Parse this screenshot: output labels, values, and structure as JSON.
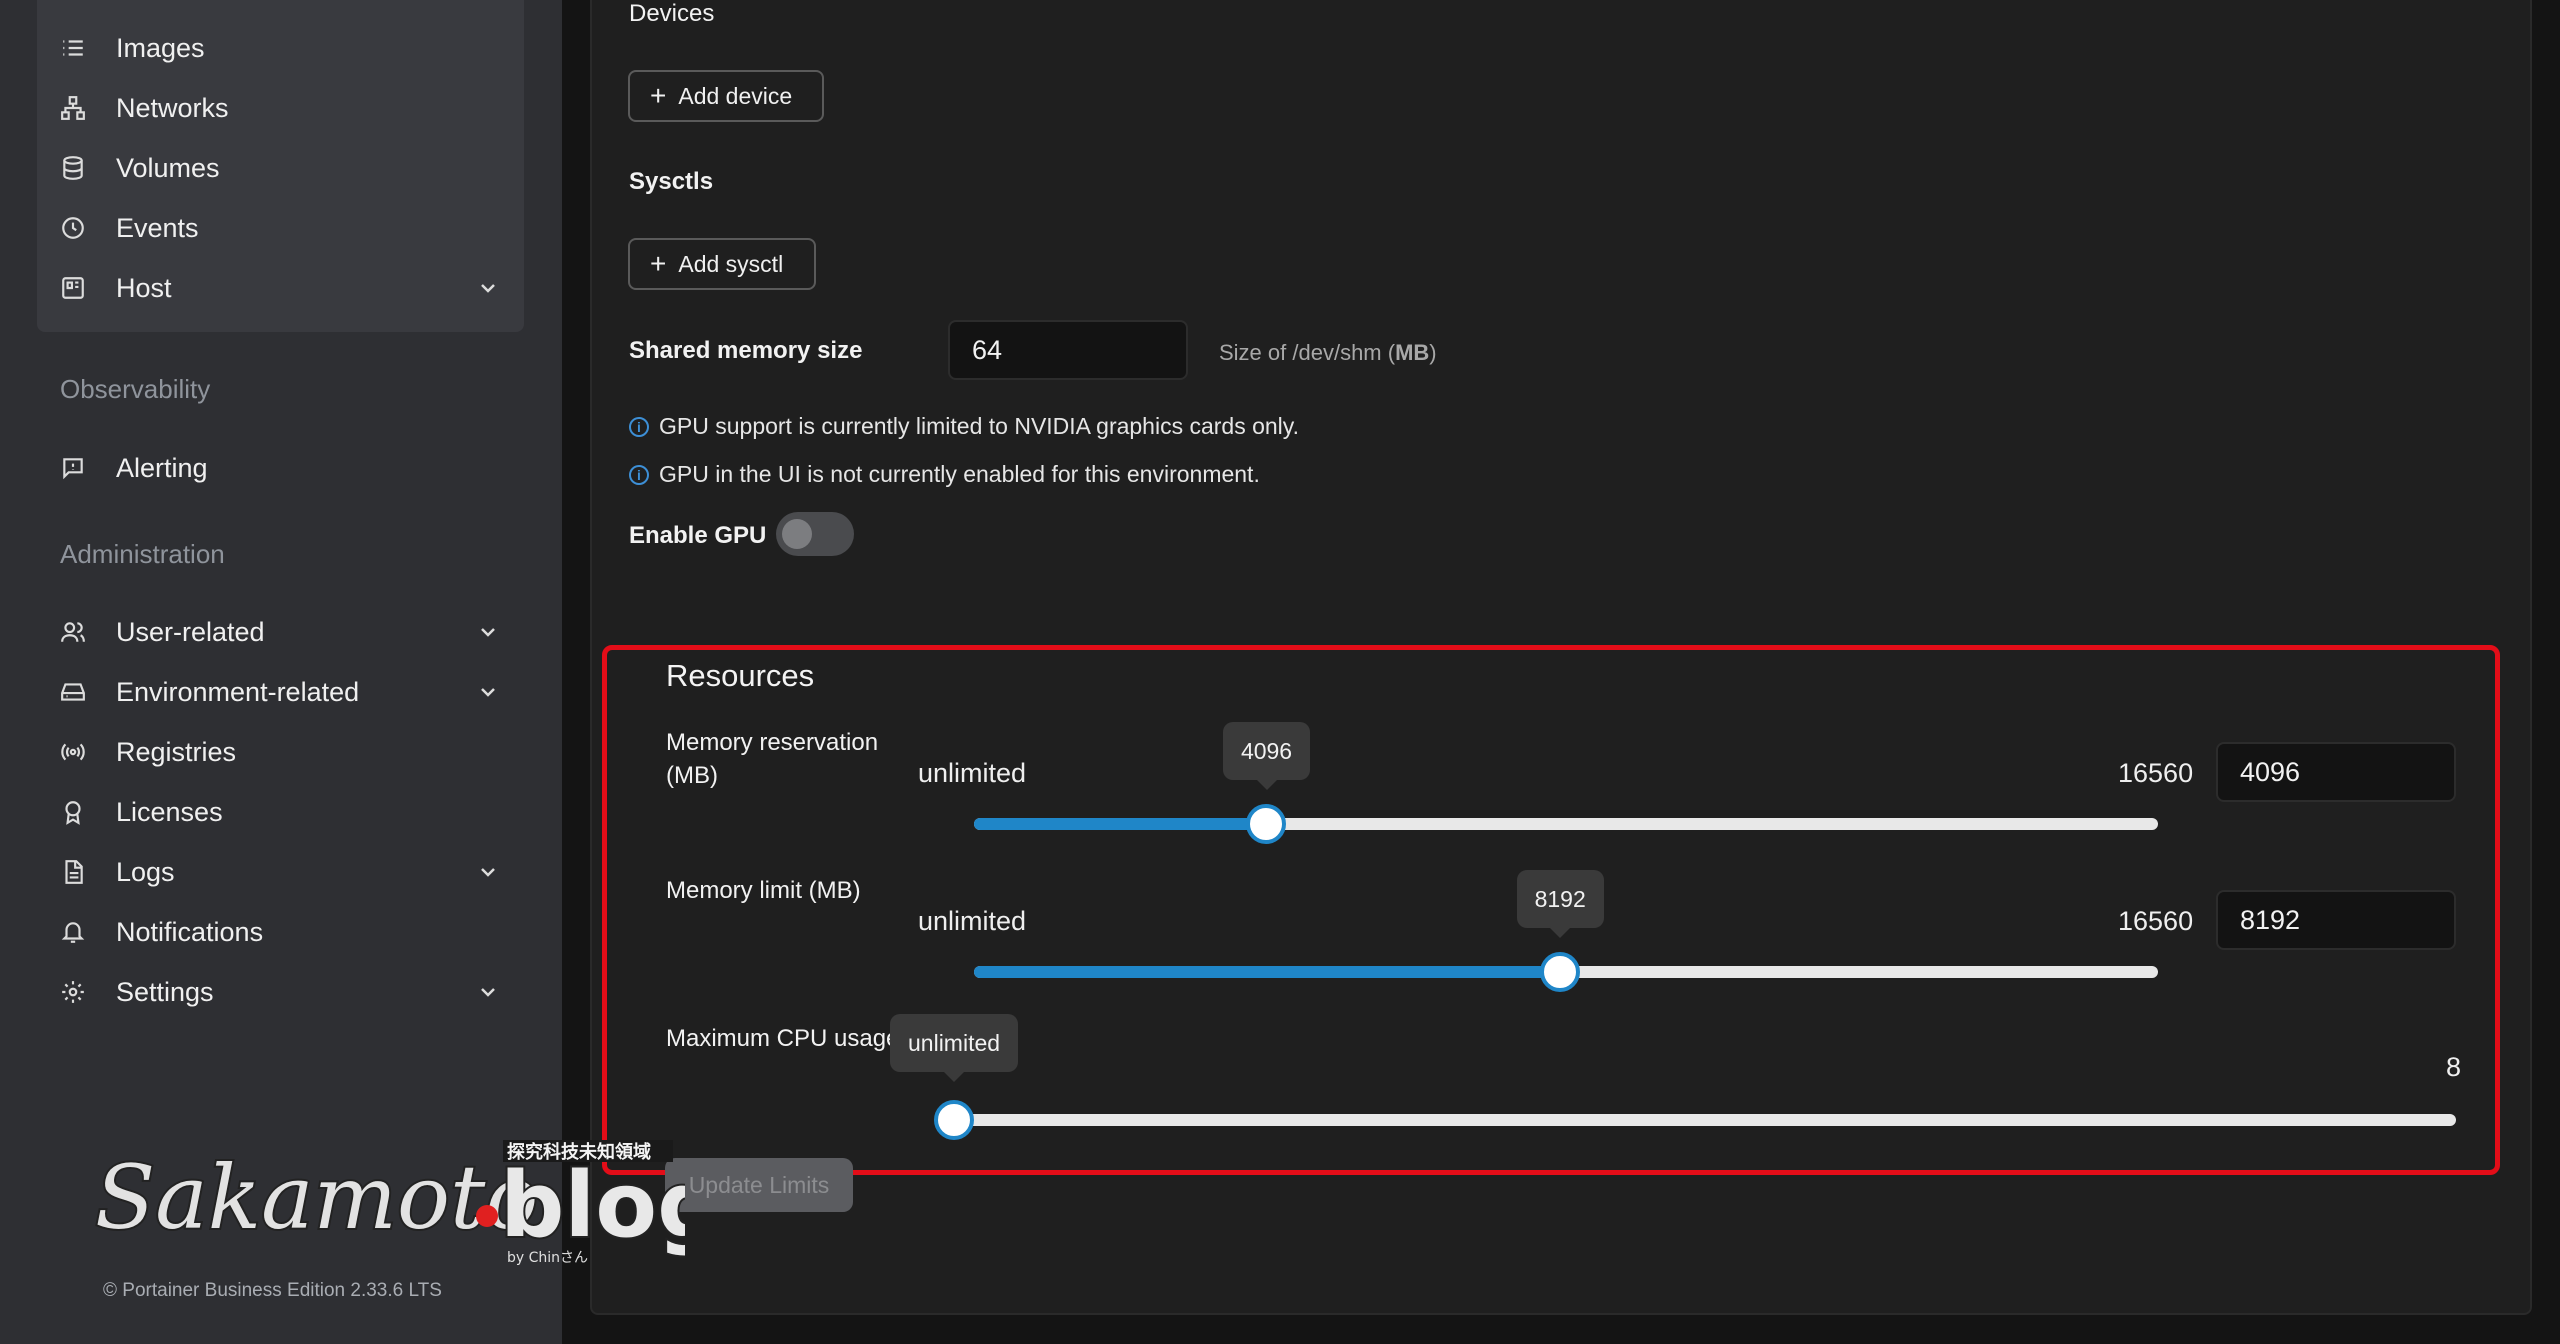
{
  "sidebar": {
    "items": [
      {
        "label": "Images",
        "icon": "list-icon"
      },
      {
        "label": "Networks",
        "icon": "network-icon"
      },
      {
        "label": "Volumes",
        "icon": "database-icon"
      },
      {
        "label": "Events",
        "icon": "clock-icon"
      },
      {
        "label": "Host",
        "icon": "host-icon"
      }
    ],
    "observability_label": "Observability",
    "alerting_label": "Alerting",
    "administration_label": "Administration",
    "admin_items": [
      {
        "label": "User-related"
      },
      {
        "label": "Environment-related"
      },
      {
        "label": "Registries"
      },
      {
        "label": "Licenses"
      },
      {
        "label": "Logs"
      },
      {
        "label": "Notifications"
      },
      {
        "label": "Settings"
      }
    ],
    "footer": "© Portainer Business Edition 2.33.6 LTS"
  },
  "watermark": {
    "text": "Sakamoto.blog",
    "subtitle": "探究科技未知領域",
    "by": "by Chinさん"
  },
  "main": {
    "devices_label": "Devices",
    "add_device_label": "Add device",
    "sysctls_label": "Sysctls",
    "add_sysctl_label": "Add sysctl",
    "shm_label": "Shared memory size",
    "shm_value": "64",
    "shm_hint_prefix": "Size of /dev/shm (",
    "shm_hint_unit": "MB",
    "shm_hint_suffix": ")",
    "gpu_info_1": "GPU support is currently limited to NVIDIA graphics cards only.",
    "gpu_info_2": "GPU in the UI is not currently enabled for this environment.",
    "enable_gpu_label": "Enable GPU",
    "enable_gpu_on": false
  },
  "resources": {
    "title": "Resources",
    "memory_reservation": {
      "label": "Memory reservation (MB)",
      "min_label": "unlimited",
      "max_label": "16560",
      "value": "4096",
      "fraction": 0.247
    },
    "memory_limit": {
      "label": "Memory limit (MB)",
      "min_label": "unlimited",
      "max_label": "16560",
      "value": "8192",
      "fraction": 0.495
    },
    "cpu": {
      "label": "Maximum CPU usage",
      "tooltip": "unlimited",
      "max_label": "8",
      "fraction": 0
    }
  },
  "update_limits_label": "Update Limits",
  "colors": {
    "accent": "#1f86c8",
    "highlight": "#e30d18"
  }
}
